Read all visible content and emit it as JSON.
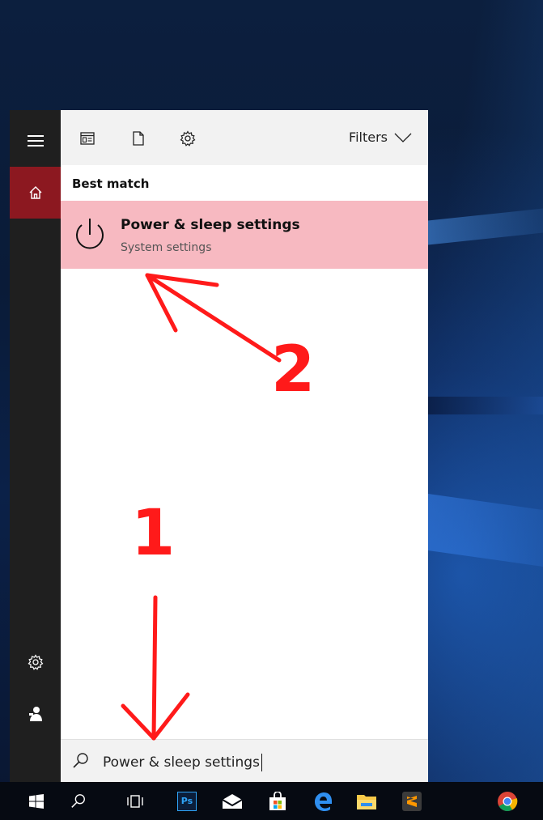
{
  "start_menu": {
    "filters_label": "Filters",
    "best_match_label": "Best match",
    "result": {
      "title": "Power & sleep settings",
      "subtitle": "System settings"
    },
    "search": {
      "value": "Power & sleep settings"
    }
  },
  "annotations": {
    "step1": "1",
    "step2": "2"
  },
  "colors": {
    "accent_home": "#8c1820",
    "result_highlight": "#f7b9c1",
    "annotation_red": "#ff1a1a"
  },
  "taskbar_icons": [
    "windows-start-icon",
    "search-icon",
    "task-view-icon",
    "photoshop-icon",
    "mail-icon",
    "store-icon",
    "edge-icon",
    "file-explorer-icon",
    "sublime-text-icon",
    "chrome-icon"
  ],
  "taskbar_labels": {
    "photoshop": "Ps"
  }
}
